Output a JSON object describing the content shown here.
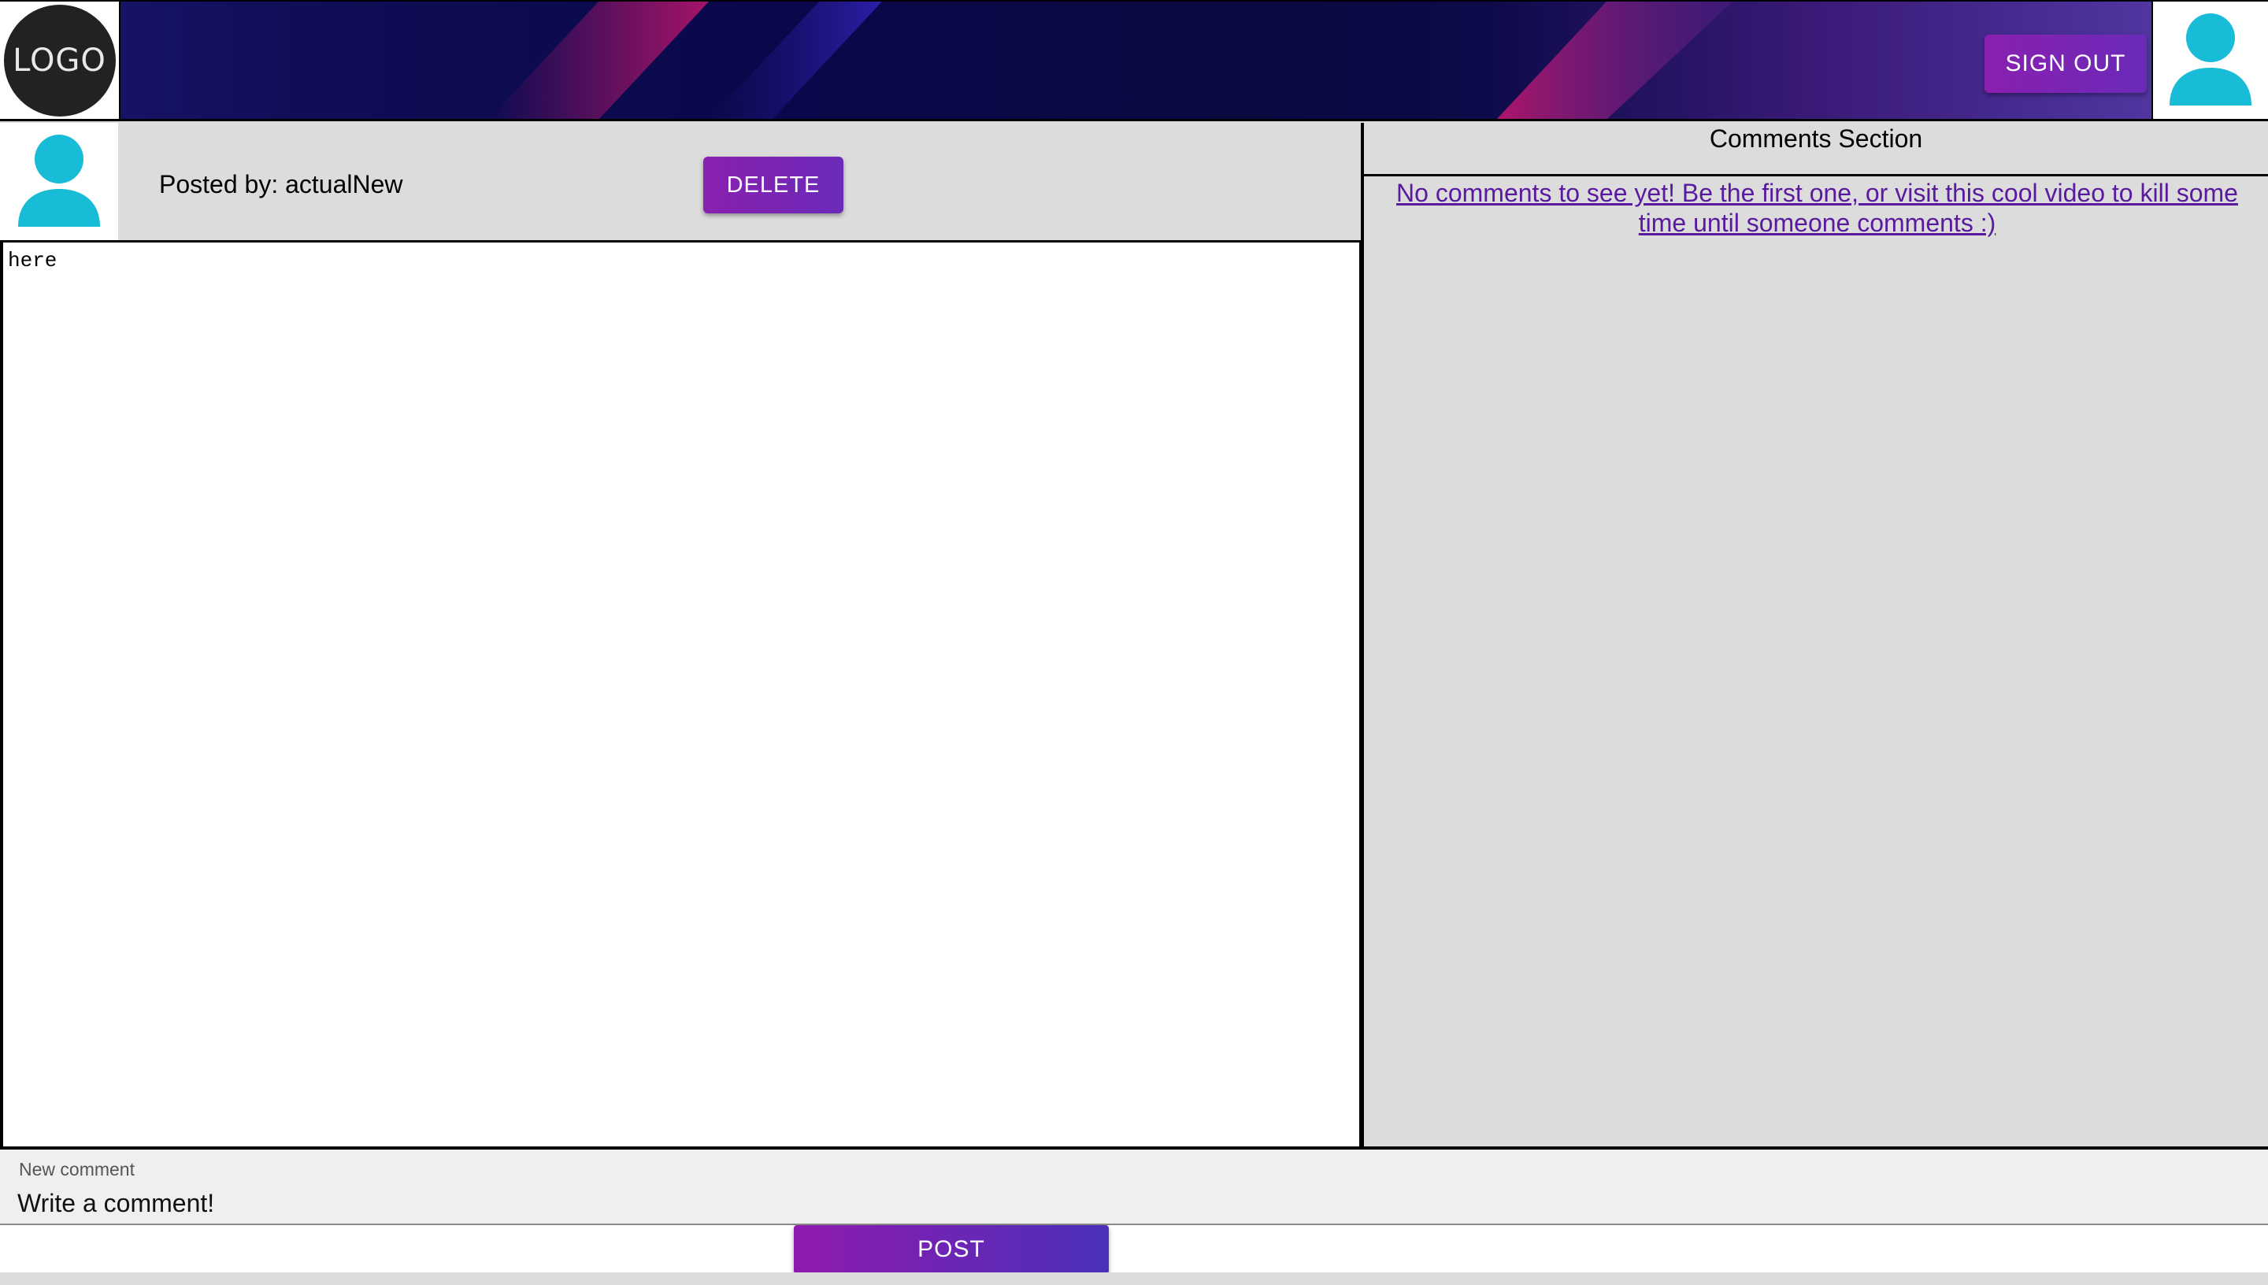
{
  "header": {
    "logo_text": "LOGO",
    "sign_out_label": "SIGN OUT",
    "gradient_colors": [
      "#1a1670",
      "#0a084a",
      "#c0166e",
      "#5840a8"
    ]
  },
  "post": {
    "posted_by": "Posted by: actualNew",
    "delete_label": "DELETE",
    "body_text": "here"
  },
  "comments": {
    "title": "Comments Section",
    "empty_link_text": "No comments to see yet! Be the first one, or visit this cool video to kill some time until someone comments :)"
  },
  "new_comment": {
    "label": "New comment",
    "placeholder": "Write a comment!",
    "post_label": "POST"
  },
  "colors": {
    "button_gradient_start": "#8a1fb0",
    "button_gradient_end": "#4a30b8",
    "avatar": "#18bcd6",
    "link": "#5a1aa0"
  },
  "icons": {
    "user_avatar": "user-avatar-icon"
  }
}
